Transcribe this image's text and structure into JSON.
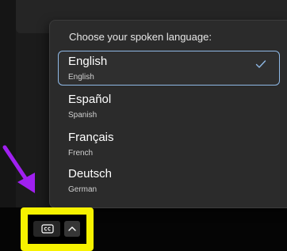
{
  "popup": {
    "heading": "Choose your spoken language:",
    "options": [
      {
        "name": "English",
        "subtitle": "English",
        "selected": true
      },
      {
        "name": "Español",
        "subtitle": "Spanish",
        "selected": false
      },
      {
        "name": "Français",
        "subtitle": "French",
        "selected": false
      },
      {
        "name": "Deutsch",
        "subtitle": "German",
        "selected": false
      }
    ],
    "selected_icon": "checkmark-icon"
  },
  "taskbar": {
    "captions_icon": "closed-captions-icon",
    "expand_icon": "chevron-up-icon"
  },
  "annotations": {
    "arrow_color": "#a020f0",
    "highlight_color": "#f7f200"
  },
  "colors": {
    "accent": "#8fb9e6",
    "popup_background": "#2b2b2b"
  }
}
